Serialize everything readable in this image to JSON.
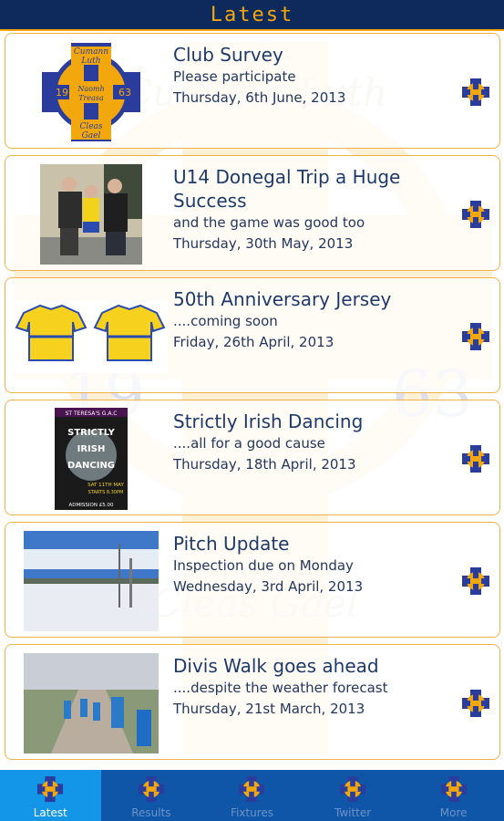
{
  "header": {
    "title": "Latest"
  },
  "crest": {
    "top_text": "Cumann Luth",
    "middle_text": "Naomh Treasa",
    "bottom_text": "Cleas Gael",
    "left_num": "19",
    "right_num": "63",
    "colors": {
      "gold": "#f2a80c",
      "blue": "#2b3d9c",
      "white": "#ffffff"
    }
  },
  "news": [
    {
      "title": "Club Survey",
      "subtitle": "Please participate",
      "date": "Thursday, 6th June, 2013",
      "thumb": "club-crest"
    },
    {
      "title": "U14 Donegal Trip a Huge Success",
      "subtitle": "and the game was good too",
      "date": "Thursday, 30th May, 2013",
      "thumb": "team-photo"
    },
    {
      "title": "50th Anniversary Jersey",
      "subtitle": "....coming soon",
      "date": "Friday, 26th April, 2013",
      "thumb": "jerseys"
    },
    {
      "title": "Strictly Irish Dancing",
      "subtitle": "....all for a good cause",
      "date": "Thursday, 18th April, 2013",
      "thumb": "poster"
    },
    {
      "title": "Pitch Update",
      "subtitle": "Inspection due on Monday",
      "date": "Wednesday, 3rd April, 2013",
      "thumb": "snowy-pitch"
    },
    {
      "title": "Divis Walk goes ahead",
      "subtitle": "....despite the weather forecast",
      "date": "Thursday, 21st March, 2013",
      "thumb": "walkers"
    }
  ],
  "poster": {
    "club": "ST TERESA'S G.A.C",
    "line1": "STRICTLY",
    "line2": "IRISH",
    "line3": "DANCING",
    "event_date": "SAT 11TH MAY",
    "event_time": "STARTS 8.30PM",
    "admission": "ADMISSION £5.00"
  },
  "tabs": [
    {
      "label": "Latest",
      "active": true
    },
    {
      "label": "Results",
      "active": false
    },
    {
      "label": "Fixtures",
      "active": false
    },
    {
      "label": "Twitter",
      "active": false
    },
    {
      "label": "More",
      "active": false
    }
  ]
}
